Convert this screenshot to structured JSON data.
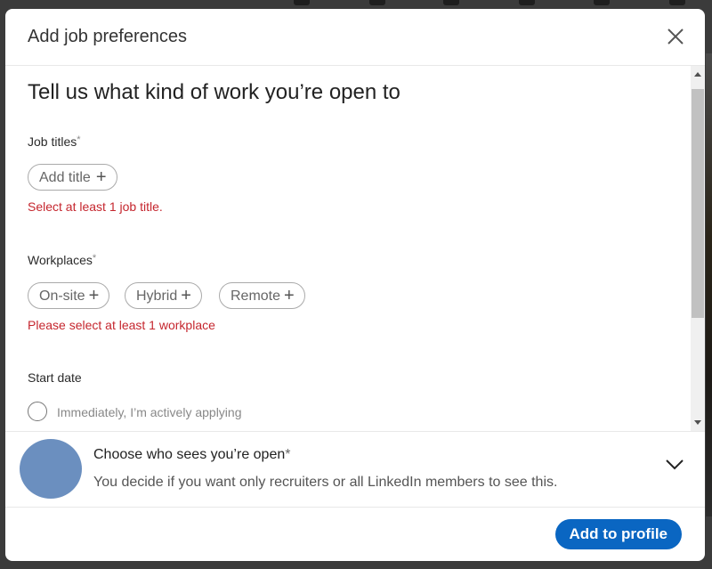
{
  "modal": {
    "title": "Add job preferences",
    "close_icon": "close-icon"
  },
  "body": {
    "headline": "Tell us what kind of work you’re open to",
    "job_titles": {
      "label": "Job titles",
      "required_mark": "*",
      "add_button": "Add title",
      "error": "Select at least 1 job title."
    },
    "workplaces": {
      "label": "Workplaces",
      "required_mark": "*",
      "options": [
        "On-site",
        "Hybrid",
        "Remote"
      ],
      "plus": "+",
      "error": "Please select at least 1 workplace"
    },
    "start_date": {
      "label": "Start date",
      "options": [
        "Immediately, I’m actively applying"
      ]
    }
  },
  "visibility": {
    "title": "Choose who sees you’re open",
    "required_mark": "*",
    "description": "You decide if you want only recruiters or all LinkedIn members to see this.",
    "avatar_color": "#6b8fbf",
    "expand_icon": "chevron-down-icon"
  },
  "footer": {
    "primary_button": "Add to profile",
    "primary_color": "#0a66c2"
  },
  "colors": {
    "error": "#c5262e",
    "overlay": "#3b3b3b"
  }
}
